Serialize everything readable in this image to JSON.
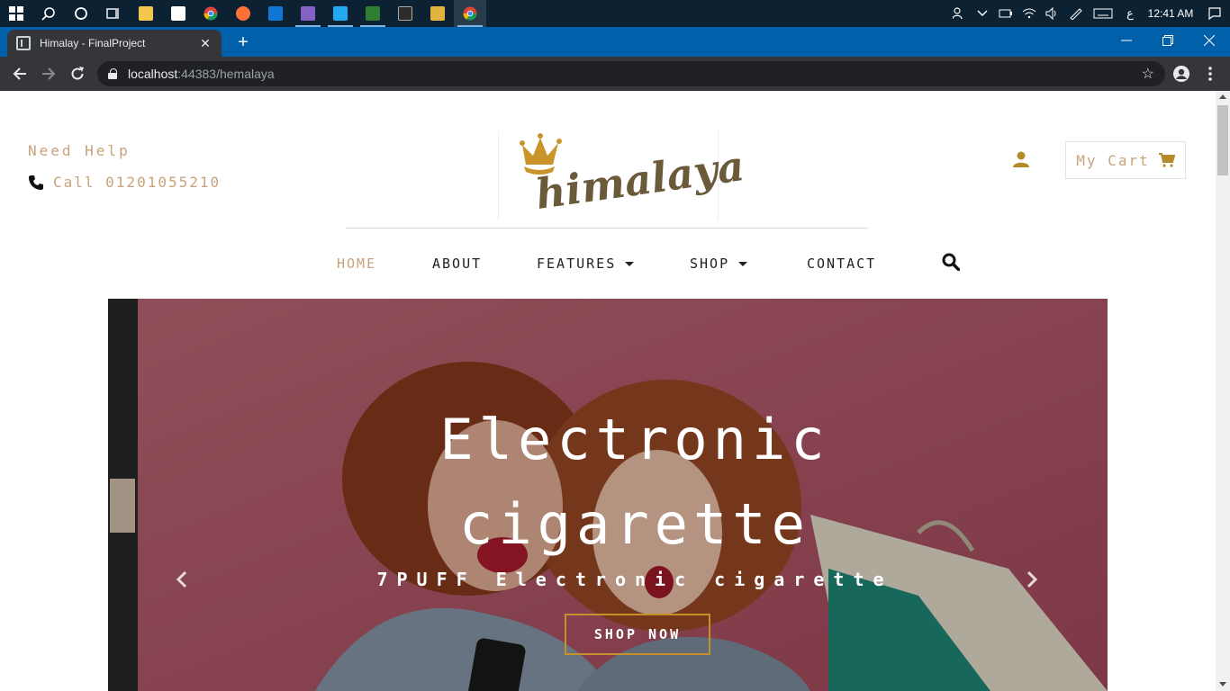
{
  "taskbar": {
    "apps": [
      {
        "name": "windows-start-icon"
      },
      {
        "name": "search-icon"
      },
      {
        "name": "cortana-icon"
      },
      {
        "name": "task-view-icon"
      },
      {
        "name": "file-explorer-icon"
      },
      {
        "name": "store-icon"
      },
      {
        "name": "chrome-icon"
      },
      {
        "name": "firefox-icon"
      },
      {
        "name": "mail-icon"
      },
      {
        "name": "visual-studio-icon"
      },
      {
        "name": "vscode-icon"
      },
      {
        "name": "clapperboard-icon"
      },
      {
        "name": "git-icon"
      },
      {
        "name": "sql-icon"
      },
      {
        "name": "chrome-active-icon"
      }
    ],
    "tray_lang": "ع",
    "clock": "12:41 AM"
  },
  "browser": {
    "tab_title": "Himalay - FinalProject",
    "tab_close": "✕",
    "new_tab": "+",
    "url_host": "localhost",
    "url_rest": ":44383/hemalaya"
  },
  "header": {
    "need_help": "Need Help",
    "call": "Call 01201055210",
    "logo_text": "himalaya",
    "cart_label": "My Cart"
  },
  "nav": {
    "items": [
      {
        "label": "HOME"
      },
      {
        "label": "ABOUT"
      },
      {
        "label": "FEATURES"
      },
      {
        "label": "SHOP"
      },
      {
        "label": "CONTACT"
      }
    ]
  },
  "hero": {
    "title_line1": "Electronic",
    "title_line2": "cigarette",
    "subtitle": "7PUFF Electronic cigarette",
    "button": "SHOP NOW",
    "prev": "‹",
    "next": "›"
  },
  "colors": {
    "accent": "#c8a27a",
    "gold": "#b58a2a",
    "hero_bg": "#b55a6a"
  }
}
